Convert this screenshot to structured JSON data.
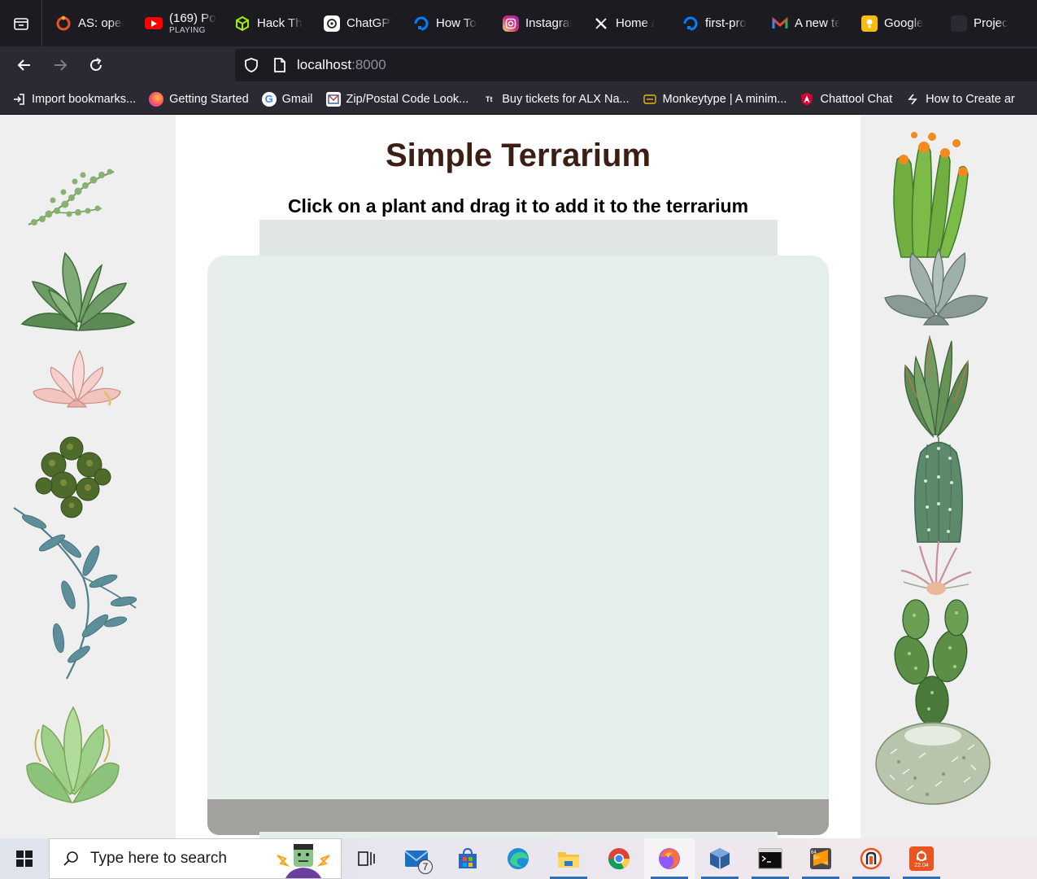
{
  "browser": {
    "tabs": [
      {
        "label": "AS: open",
        "icon": "ubuntu-icon",
        "color": "#e95420"
      },
      {
        "label": "(169) Po",
        "sub": "PLAYING",
        "icon": "youtube-icon",
        "color": "#ff0000"
      },
      {
        "label": "Hack The",
        "icon": "hackthebox-icon",
        "color": "#9fef00"
      },
      {
        "label": "ChatGPT",
        "icon": "chatgpt-icon",
        "color": "#ffffff"
      },
      {
        "label": "How To",
        "icon": "digitalocean-icon",
        "color": "#0080ff"
      },
      {
        "label": "Instagram",
        "icon": "instagram-icon",
        "color": "#d62976"
      },
      {
        "label": "Home /",
        "icon": "x-icon",
        "color": "#ffffff"
      },
      {
        "label": "first-pro",
        "icon": "digitalocean-icon",
        "color": "#0080ff"
      },
      {
        "label": "A new te",
        "icon": "gmail-icon",
        "color": "#ea4335"
      },
      {
        "label": "Google",
        "icon": "keep-icon",
        "color": "#fbbc04"
      },
      {
        "label": "Project:",
        "icon": "project-icon",
        "color": "#3a3a3a"
      }
    ],
    "url_host": "localhost",
    "url_port": ":8000",
    "bookmarks": [
      {
        "label": "Import bookmarks...",
        "icon": "import-icon"
      },
      {
        "label": "Getting Started",
        "icon": "firefox-icon"
      },
      {
        "label": "Gmail",
        "icon": "google-icon"
      },
      {
        "label": "Zip/Postal Code Look...",
        "icon": "mail-icon"
      },
      {
        "label": "Buy tickets for ALX Na...",
        "icon": "tt-icon"
      },
      {
        "label": "Monkeytype | A minim...",
        "icon": "keyboard-icon"
      },
      {
        "label": "Chattool Chat",
        "icon": "angular-icon"
      },
      {
        "label": "How to Create ar",
        "icon": "bolt-icon"
      }
    ]
  },
  "page": {
    "title": "Simple Terrarium",
    "subtitle": "Click on a plant and drag it to add it to the terrarium"
  },
  "plants": {
    "left": [
      "plant1",
      "plant2",
      "plant3",
      "plant4",
      "plant5",
      "plant6",
      "plant7"
    ],
    "right": [
      "plant8",
      "plant9",
      "plant10",
      "plant11",
      "plant12",
      "plant13",
      "plant14"
    ]
  },
  "taskbar": {
    "search_placeholder": "Type here to search",
    "mail_badge": "7",
    "apps": [
      "task-view-icon",
      "mail-icon",
      "store-icon",
      "edge-icon",
      "file-explorer-icon",
      "chrome-icon",
      "firefox-icon",
      "virtualbox-icon",
      "terminal-icon",
      "sublime-icon",
      "ubuntu-pro-icon",
      "ubuntu-22-icon"
    ],
    "ubuntu_label": "22.04"
  }
}
